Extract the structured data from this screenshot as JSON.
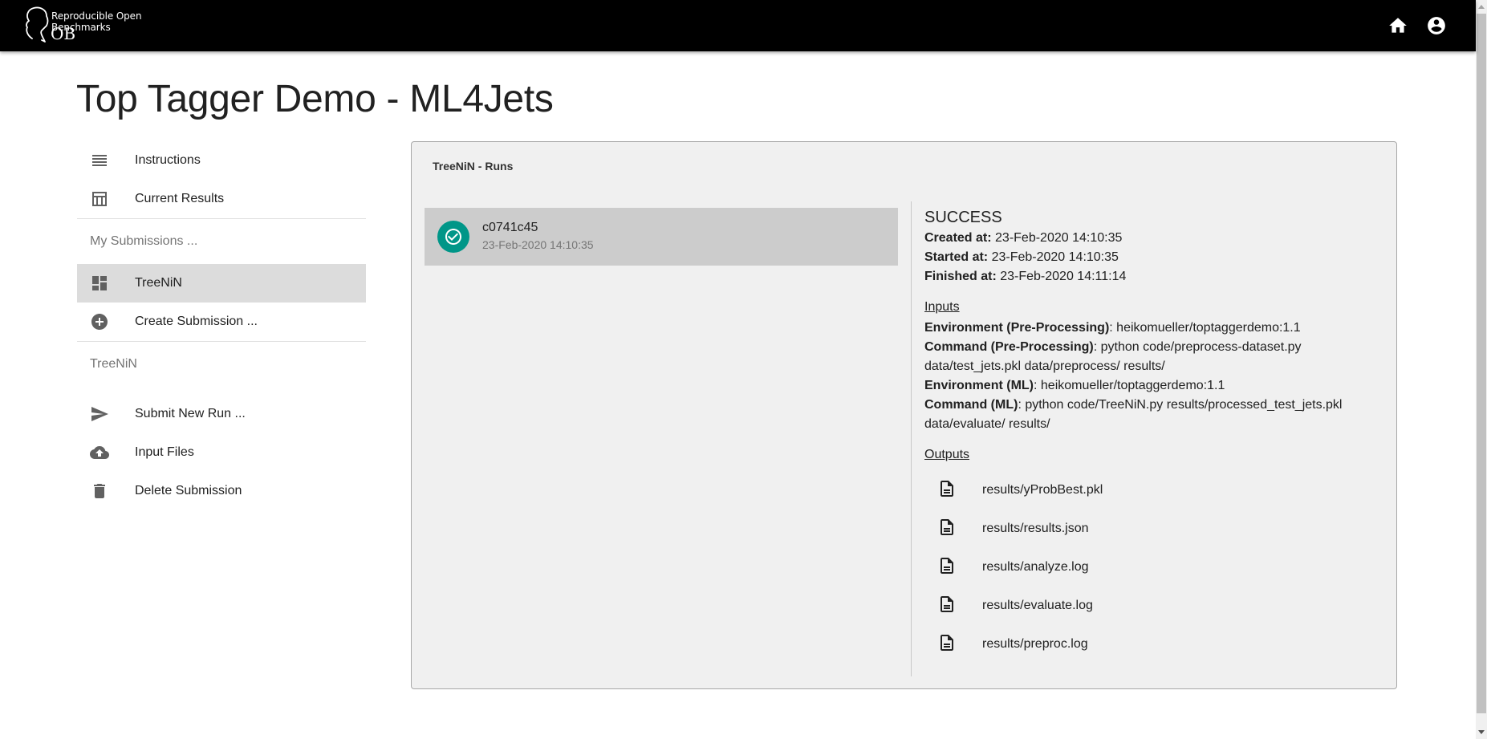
{
  "appbar": {
    "logo_subtitle": "Reproducible Open Benchmarks",
    "logo_mark": "OB",
    "icons": [
      "home-icon",
      "account-circle-icon"
    ]
  },
  "page": {
    "title": "Top Tagger Demo - ML4Jets"
  },
  "sidebar": {
    "items": [
      {
        "label": "Instructions",
        "icon": "list-lines-icon"
      },
      {
        "label": "Current Results",
        "icon": "table-icon"
      }
    ],
    "my_submissions_header": "My Submissions ...",
    "submissions": [
      {
        "label": "TreeNiN",
        "icon": "dashboard-icon",
        "active": true
      },
      {
        "label": "Create Submission ...",
        "icon": "add-circle-icon"
      }
    ],
    "submission_header": "TreeNiN",
    "submission_actions": [
      {
        "label": "Submit New Run ...",
        "icon": "send-icon"
      },
      {
        "label": "Input Files",
        "icon": "cloud-upload-icon"
      },
      {
        "label": "Delete Submission",
        "icon": "trash-icon"
      }
    ]
  },
  "runs_panel": {
    "title": "TreeNiN - Runs",
    "runs": [
      {
        "id": "c0741c45",
        "date": "23-Feb-2020 14:10:35",
        "status_icon": "check-circle-icon",
        "status_color": "#009688"
      }
    ]
  },
  "run_details": {
    "status": "SUCCESS",
    "created_label": "Created at:",
    "created": "23-Feb-2020 14:10:35",
    "started_label": "Started at:",
    "started": "23-Feb-2020 14:10:35",
    "finished_label": "Finished at:",
    "finished": "23-Feb-2020 14:11:14",
    "inputs_title": "Inputs",
    "inputs": [
      {
        "label": "Environment (Pre-Processing)",
        "value": "heikomueller/toptaggerdemo:1.1"
      },
      {
        "label": "Command (Pre-Processing)",
        "value": "python code/preprocess-dataset.py data/test_jets.pkl data/preprocess/ results/"
      },
      {
        "label": "Environment (ML)",
        "value": "heikomueller/toptaggerdemo:1.1"
      },
      {
        "label": "Command (ML)",
        "value": "python code/TreeNiN.py results/processed_test_jets.pkl data/evaluate/ results/"
      }
    ],
    "outputs_title": "Outputs",
    "outputs": [
      "results/yProbBest.pkl",
      "results/results.json",
      "results/analyze.log",
      "results/evaluate.log",
      "results/preproc.log"
    ]
  }
}
